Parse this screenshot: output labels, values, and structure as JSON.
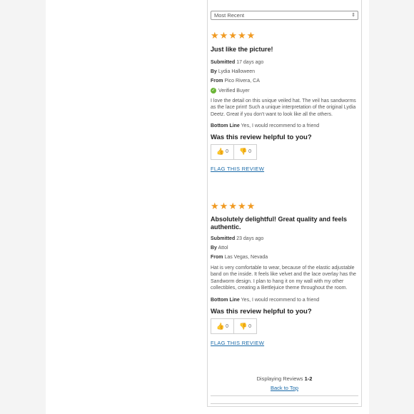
{
  "sort": {
    "selected": "Most Recent",
    "chevron": "⇕"
  },
  "reviews": [
    {
      "rating": 5,
      "title": "Just like the picture!",
      "submitted_label": "Submitted",
      "submitted_value": "17 days ago",
      "by_label": "By",
      "by_value": "Lydia Halloween",
      "from_label": "From",
      "from_value": "Pico Rivera, CA",
      "verified": "Verified Buyer",
      "body": "I love the detail on this unique veiled hat. The veil has sandworms as the lace print! Such a unique interpretation of the original Lydia Deetz. Great if you don't want to look like all the others.",
      "bottom_line_label": "Bottom Line",
      "bottom_line_value": "Yes, I would recommend to a friend",
      "helpful_question": "Was this review helpful to you?",
      "up_count": "0",
      "down_count": "0",
      "flag": "FLAG THIS REVIEW"
    },
    {
      "rating": 5,
      "title": "Absolutely delightful! Great quality and feels authentic.",
      "submitted_label": "Submitted",
      "submitted_value": "23 days ago",
      "by_label": "By",
      "by_value": "Attol",
      "from_label": "From",
      "from_value": "Las Vegas, Nevada",
      "body": "Hat is very comfortable to wear, because of the elastic adjustable band on the inside. It feels like velvet and the lace overlay has the Sandworm design. I plan to hang it on my wall with my other collectibles, creating a Bettlejuice theme throughout the room.",
      "bottom_line_label": "Bottom Line",
      "bottom_line_value": "Yes, I would recommend to a friend",
      "helpful_question": "Was this review helpful to you?",
      "up_count": "0",
      "down_count": "0",
      "flag": "FLAG THIS REVIEW"
    }
  ],
  "footer": {
    "displaying_label": "Displaying Reviews",
    "displaying_range": "1-2",
    "back_to_top": "Back to Top"
  },
  "colors": {
    "star": "#f09a22",
    "link": "#1a6aa8",
    "verified": "#6ab536"
  }
}
